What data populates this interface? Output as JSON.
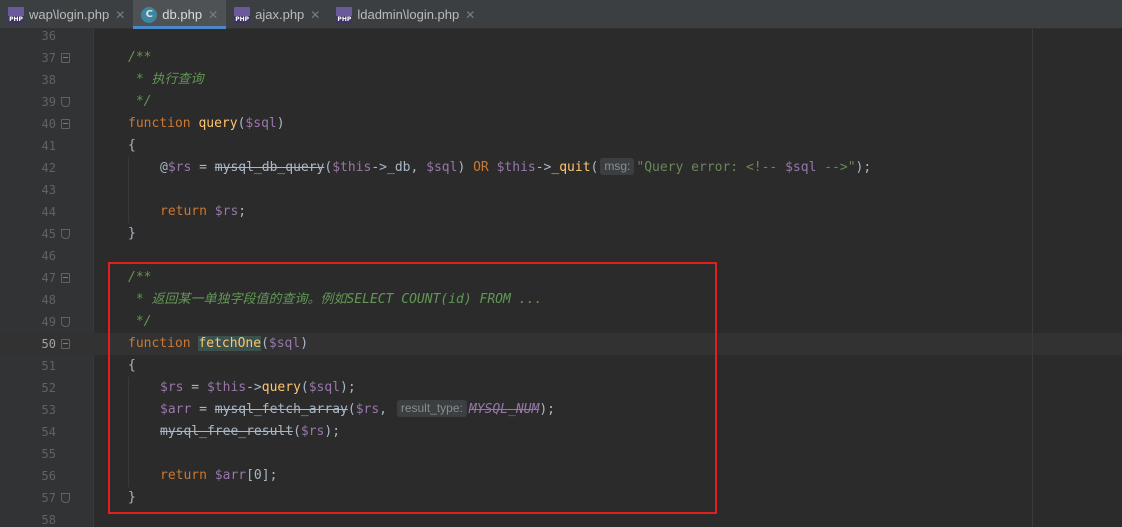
{
  "tabs": [
    {
      "label": "wap\\login.php",
      "icon": "php-file-icon",
      "active": false
    },
    {
      "label": "db.php",
      "icon": "class-file-icon",
      "active": true
    },
    {
      "label": "ajax.php",
      "icon": "php-file-icon",
      "active": false
    },
    {
      "label": "ldadmin\\login.php",
      "icon": "php-file-icon",
      "active": false
    }
  ],
  "tab_close_glyph": "✕",
  "line_numbers": [
    "36",
    "37",
    "38",
    "39",
    "40",
    "41",
    "42",
    "43",
    "44",
    "45",
    "46",
    "47",
    "48",
    "49",
    "50",
    "51",
    "52",
    "53",
    "54",
    "55",
    "56",
    "57",
    "58"
  ],
  "current_line": "50",
  "code": {
    "l37": "/**",
    "l38": " * 执行查询",
    "l39": " */",
    "l40_kw": "function",
    "l40_fn": "query",
    "l40_p1": "(",
    "l40_var": "$sql",
    "l40_p2": ")",
    "l41": "{",
    "l42_at": "@",
    "l42_rs": "$rs",
    "l42_eq": " = ",
    "l42_fn": "mysql_db_query",
    "l42_p1": "(",
    "l42_this": "$this",
    "l42_arrow": "->_db, ",
    "l42_sql": "$sql",
    "l42_p2": ") ",
    "l42_or": "OR",
    "l42_sp": " ",
    "l42_this2": "$this",
    "l42_arrow2": "->",
    "l42_quit": "_quit",
    "l42_p3": "(",
    "l42_hint": "msg:",
    "l42_str1": "\"Query error: <!-- ",
    "l42_svar": "$sql",
    "l42_str2": " -->\"",
    "l42_end": ");",
    "l44_kw": "return",
    "l44_var": "$rs",
    "l44_end": ";",
    "l45": "}",
    "l47": "/**",
    "l48": " * 返回某一单独字段值的查询。例如SELECT COUNT(id) FROM ...",
    "l49": " */",
    "l50_kw": "function",
    "l50_fn": "fetchOne",
    "l50_p1": "(",
    "l50_var": "$sql",
    "l50_p2": ")",
    "l51": "{",
    "l52_rs": "$rs",
    "l52_eq": " = ",
    "l52_this": "$this",
    "l52_arrow": "->",
    "l52_fn": "query",
    "l52_p1": "(",
    "l52_var": "$sql",
    "l52_p2": ");",
    "l53_arr": "$arr",
    "l53_eq": " = ",
    "l53_fn": "mysql_fetch_array",
    "l53_p1": "(",
    "l53_rs": "$rs",
    "l53_comma": ", ",
    "l53_hint": "result_type:",
    "l53_const": "MYSQL_NUM",
    "l53_end": ");",
    "l54_fn": "mysql_free_result",
    "l54_p1": "(",
    "l54_rs": "$rs",
    "l54_end": ");",
    "l56_kw": "return",
    "l56_var": "$arr",
    "l56_idx": "[0];",
    "l57": "}"
  },
  "colors": {
    "background": "#2b2b2b",
    "keyword": "#cc7832",
    "variable": "#9876aa",
    "function": "#ffc66d",
    "string": "#6a8759",
    "doc_comment": "#629755",
    "highlight_box": "#e0201e"
  }
}
